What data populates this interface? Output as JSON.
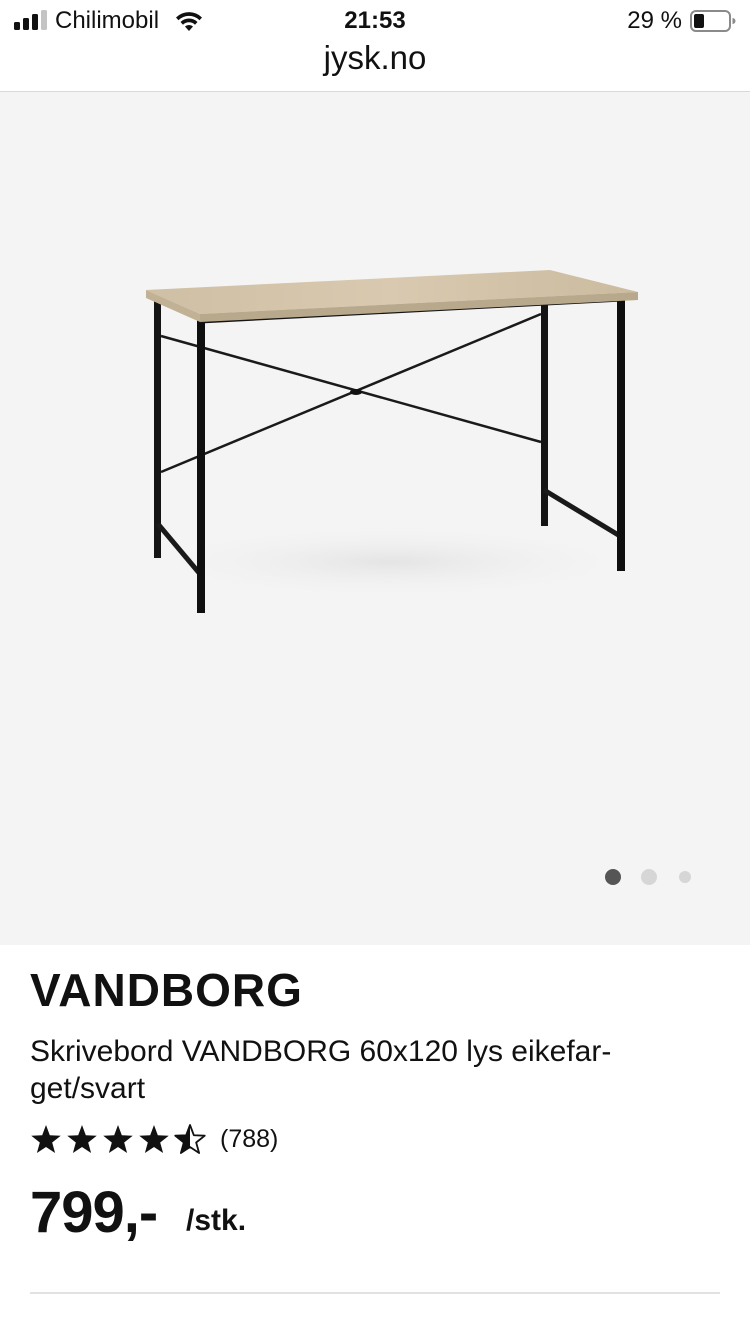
{
  "status_bar": {
    "carrier": "Chilimobil",
    "time": "21:53",
    "battery_percent": "29 %",
    "signal_bars_active": 3,
    "signal_bars_total": 4,
    "battery_level": 0.29
  },
  "browser": {
    "url": "jysk.no"
  },
  "gallery": {
    "image_icon": "desk-product-image",
    "slide_count": 3,
    "active_slide": 1
  },
  "product": {
    "brand": "VANDBORG",
    "description": "Skrivebord VANDBORG 60x120 lys eikefar-get/svart",
    "rating": 4.5,
    "rating_max": 5,
    "review_count": "(788)",
    "price": "799,-",
    "unit": "/stk."
  },
  "colors": {
    "text": "#111111",
    "gallery_background": "#f4f4f4",
    "dot_active": "#555555",
    "dot_inactive": "#d6d6d6"
  }
}
